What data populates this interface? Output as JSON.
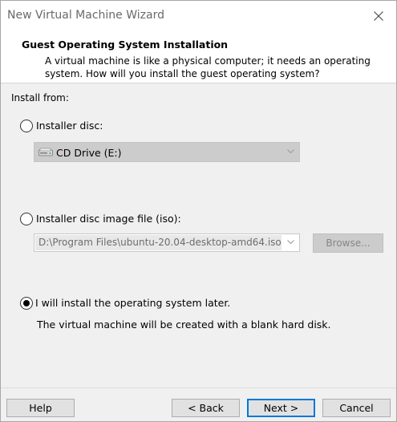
{
  "window": {
    "title": "New Virtual Machine Wizard"
  },
  "header": {
    "title": "Guest Operating System Installation",
    "description": "A virtual machine is like a physical computer; it needs an operating system. How will you install the guest operating system?"
  },
  "install_from": {
    "label": "Install from:",
    "options": [
      {
        "label": "Installer disc:",
        "selected": false
      },
      {
        "label": "Installer disc image file (iso):",
        "selected": false
      },
      {
        "label": "I will install the operating system later.",
        "selected": true
      }
    ],
    "disc_drive": {
      "value": "CD Drive (E:)",
      "icon": "cd-drive-icon"
    },
    "iso_path": {
      "value": "D:\\Program Files\\ubuntu-20.04-desktop-amd64.iso"
    },
    "browse_label": "Browse...",
    "later_description": "The virtual machine will be created with a blank hard disk."
  },
  "buttons": {
    "help": "Help",
    "back": "< Back",
    "next": "Next >",
    "cancel": "Cancel"
  },
  "colors": {
    "accent": "#0078d7",
    "header_bg": "#ffffff",
    "body_bg": "#f0f0f0"
  }
}
